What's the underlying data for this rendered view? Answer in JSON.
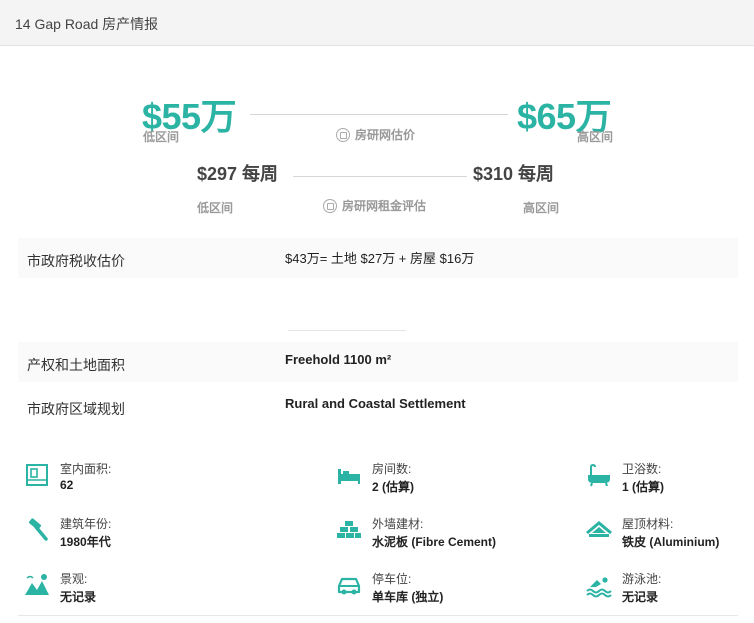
{
  "header": {
    "title": "14 Gap Road 房产情报"
  },
  "price": {
    "low": "$55万",
    "low_label": "低区间",
    "high": "$65万",
    "high_label": "高区间",
    "estimate_label": "房研网估价"
  },
  "rent": {
    "low": "$297 每周",
    "low_label": "低区间",
    "high": "$310 每周",
    "high_label": "高区间",
    "estimate_label": "房研网租金评估"
  },
  "details": {
    "rates_label": "市政府税收估价",
    "rates_value": "$43万= 土地 $27万 + 房屋 $16万",
    "title_label": "产权和土地面积",
    "title_value": "Freehold 1100 m²",
    "zone_label": "市政府区域规划",
    "zone_value": "Rural and Coastal Settlement"
  },
  "features": [
    {
      "icon": "floor-area-icon",
      "label": "室内面积:",
      "value": "62"
    },
    {
      "icon": "bed-icon",
      "label": "房间数:",
      "value": "2 (估算)"
    },
    {
      "icon": "bathtub-icon",
      "label": "卫浴数:",
      "value": "1 (估算)"
    },
    {
      "icon": "hammer-icon",
      "label": "建筑年份:",
      "value": "1980年代"
    },
    {
      "icon": "brick-wall-icon",
      "label": "外墙建材:",
      "value": "水泥板 (Fibre Cement)"
    },
    {
      "icon": "roof-icon",
      "label": "屋顶材料:",
      "value": "铁皮 (Aluminium)"
    },
    {
      "icon": "view-icon",
      "label": "景观:",
      "value": "无记录"
    },
    {
      "icon": "car-icon",
      "label": "停车位:",
      "value": "单车库 (独立)"
    },
    {
      "icon": "swimming-icon",
      "label": "游泳池:",
      "value": "无记录"
    }
  ],
  "colors": {
    "accent": "#2bb3a4",
    "header_bg": "#f4f4f5"
  }
}
